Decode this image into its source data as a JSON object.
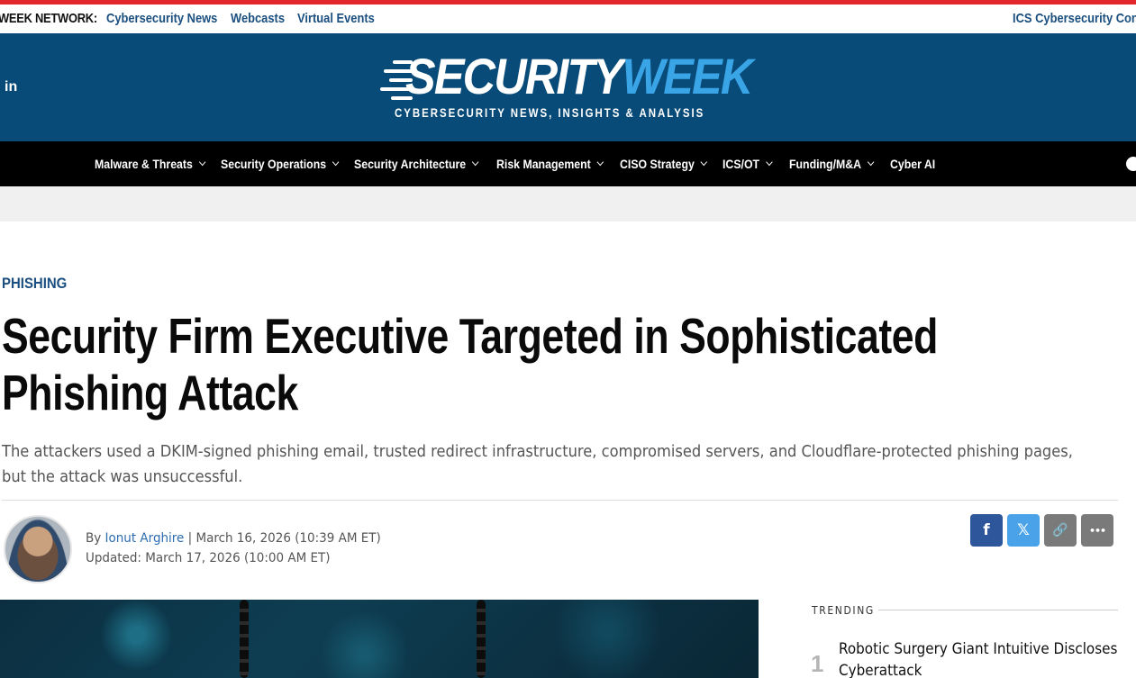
{
  "network": {
    "label": "WEEK NETWORK:",
    "links": [
      "Cybersecurity News",
      "Webcasts",
      "Virtual Events"
    ],
    "right_link": "ICS Cybersecurity Con"
  },
  "header": {
    "logo_primary": "SECURITY",
    "logo_accent": "WEEK",
    "tagline": "CYBERSECURITY NEWS, INSIGHTS & ANALYSIS",
    "social_icon": "linkedin-icon",
    "linkedin_glyph": "in"
  },
  "nav": {
    "items": [
      {
        "label": "Malware & Threats",
        "dropdown": true
      },
      {
        "label": "Security Operations",
        "dropdown": true
      },
      {
        "label": "Security Architecture",
        "dropdown": true
      },
      {
        "label": "Risk Management",
        "dropdown": true
      },
      {
        "label": "CISO Strategy",
        "dropdown": true
      },
      {
        "label": "ICS/OT",
        "dropdown": true
      },
      {
        "label": "Funding/M&A",
        "dropdown": true
      },
      {
        "label": "Cyber AI",
        "dropdown": false
      }
    ]
  },
  "article": {
    "category": "PHISHING",
    "headline_lines": [
      "Security Firm Executive Targeted in Sophisticated",
      "Phishing Attack"
    ],
    "deck_lines": [
      "The attackers used a DKIM-signed phishing email, trusted redirect infrastructure, compromised servers, and Cloudflare-protected phishing pages,",
      "but the attack was unsuccessful."
    ],
    "by": "By",
    "author": "Ionut Arghire",
    "date": "| March 16, 2026 (10:39 AM ET)",
    "updated": "Updated: March 17, 2026 (10:00 AM ET)"
  },
  "share": {
    "facebook_glyph": "f",
    "x_glyph": "𝕏",
    "link_glyph": "🔗",
    "more_glyph": "•••"
  },
  "trending": {
    "label": "TRENDING",
    "items": [
      {
        "rank": "1",
        "title_lines": [
          "Robotic Surgery Giant Intuitive Discloses",
          "Cyberattack"
        ]
      }
    ]
  },
  "colors": {
    "accent_red": "#e3262b",
    "brand_blue": "#084a78",
    "logo_accent": "#3aa5e6",
    "link_blue": "#1a4f7f",
    "facebook": "#2d579a",
    "x_blue": "#4aa3e8"
  }
}
